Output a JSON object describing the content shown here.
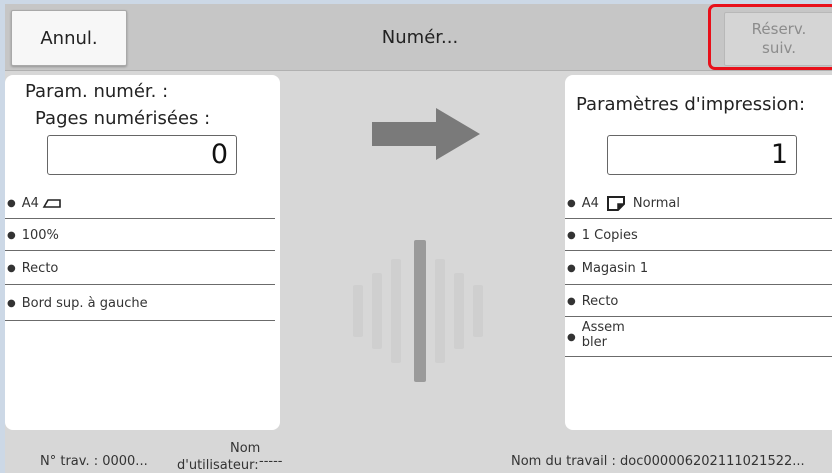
{
  "header": {
    "cancel_label": "Annul.",
    "title": "Numér...",
    "reserve_line1": "Réserv.",
    "reserve_line2": "suiv."
  },
  "scan_panel": {
    "title": "Param. numér. :",
    "pages_label": "Pages numérisées :",
    "pages_count": "0",
    "items": [
      "A4",
      "100%",
      "Recto",
      "Bord sup. à gauche"
    ]
  },
  "print_panel": {
    "title": "Paramètres d'impression:",
    "copies_count": "1",
    "items": [
      "A4",
      "1 Copies",
      "Magasin 1",
      "Recto"
    ],
    "paper_type": "Normal",
    "collate_line1": "Assem",
    "collate_line2": "bler"
  },
  "footer": {
    "job_no": "N° trav. : 0000...",
    "user_label_line1": "Nom",
    "user_label_line2": "d'utilisateur:",
    "user_value": "-----",
    "job_name": "Nom du travail : doc000006202111021522..."
  },
  "icons": {
    "paper_landscape": "paper-landscape-icon",
    "paper_portrait": "paper-portrait-icon",
    "arrow": "arrow-right-icon",
    "activity": "scan-activity-icon"
  },
  "colors": {
    "highlight": "#e8101a",
    "background": "#d7d7d7",
    "topbar": "#c6c6c6"
  }
}
